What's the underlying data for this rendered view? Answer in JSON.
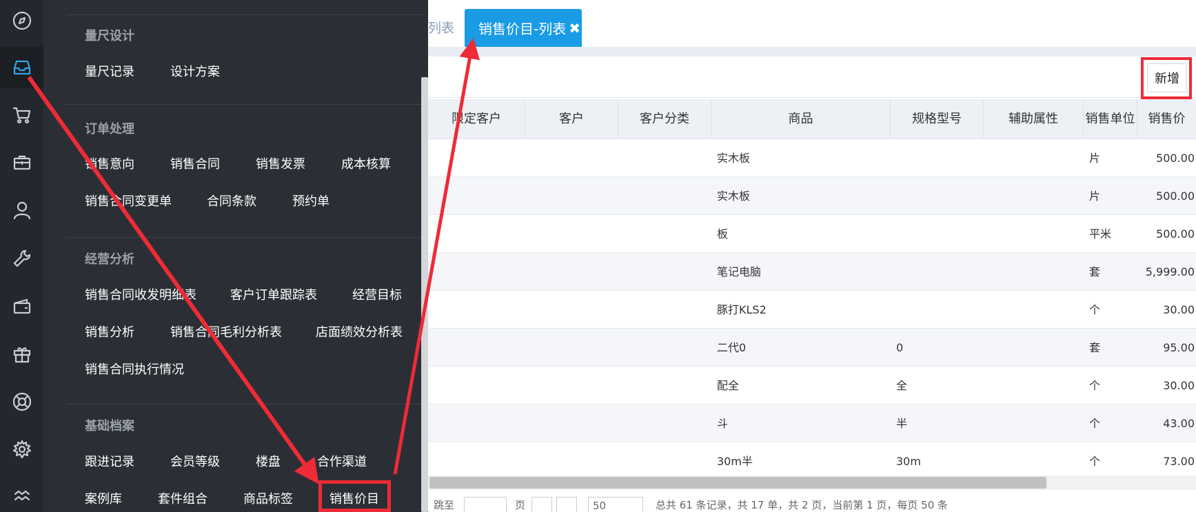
{
  "rail": {
    "icons": [
      "compass-icon",
      "inbox-icon",
      "cart-icon",
      "briefcase-icon",
      "user-icon",
      "wrench-icon",
      "wallet-icon",
      "gift-icon",
      "lifebuoy-icon",
      "gear-icon",
      "double-chevron-icon"
    ]
  },
  "menu": {
    "sections": [
      {
        "title": "量尺设计",
        "items": [
          "量尺记录",
          "设计方案"
        ]
      },
      {
        "title": "订单处理",
        "items": [
          "销售意向",
          "销售合同",
          "销售发票",
          "成本核算",
          "销售合同变更单",
          "合同条款",
          "预约单"
        ]
      },
      {
        "title": "经营分析",
        "items": [
          "销售合同收发明细表",
          "客户订单跟踪表",
          "经营目标",
          "销售分析",
          "销售合同毛利分析表",
          "店面绩效分析表",
          "销售合同执行情况"
        ]
      },
      {
        "title": "基础档案",
        "items": [
          "跟进记录",
          "会员等级",
          "楼盘",
          "合作渠道",
          "案例库",
          "套件组合",
          "商品标签",
          "销售价目"
        ]
      }
    ]
  },
  "tabs": {
    "prev_label": "列表",
    "active_label": "销售价目-列表",
    "close_glyph": "✖"
  },
  "toolbar": {
    "add_label": "新增"
  },
  "table": {
    "columns": [
      "限定客户",
      "客户",
      "客户分类",
      "商品",
      "规格型号",
      "辅助属性",
      "销售单位",
      "销售价"
    ],
    "rows": [
      {
        "product": "实木板",
        "spec": "",
        "unit": "片",
        "price": "500.00"
      },
      {
        "product": "实木板",
        "spec": "",
        "unit": "片",
        "price": "500.00"
      },
      {
        "product": "板",
        "spec": "",
        "unit": "平米",
        "price": "500.00"
      },
      {
        "product": "笔记电脑",
        "spec": "",
        "unit": "套",
        "price": "5,999.00"
      },
      {
        "product": "豚打KLS2",
        "spec": "",
        "unit": "个",
        "price": "30.00"
      },
      {
        "product": "二代0",
        "spec": "0",
        "unit": "套",
        "price": "95.00"
      },
      {
        "product": "配全",
        "spec": "全",
        "unit": "个",
        "price": "30.00"
      },
      {
        "product": "斗",
        "spec": "半",
        "unit": "个",
        "price": "43.00"
      },
      {
        "product": "30m半",
        "spec": "30m",
        "unit": "个",
        "price": "73.00"
      }
    ]
  },
  "pager": {
    "goto_label": "跳至",
    "page_suffix": "页",
    "page_size": "50",
    "summary": "总共 61 条记录，共 17 单，共 2 页，当前第 1 页，每页 50 条"
  },
  "colors": {
    "accent": "#1a9be6",
    "highlight": "#ee2b36",
    "menu_bg": "#2b2f35",
    "rail_bg": "#23272e"
  }
}
